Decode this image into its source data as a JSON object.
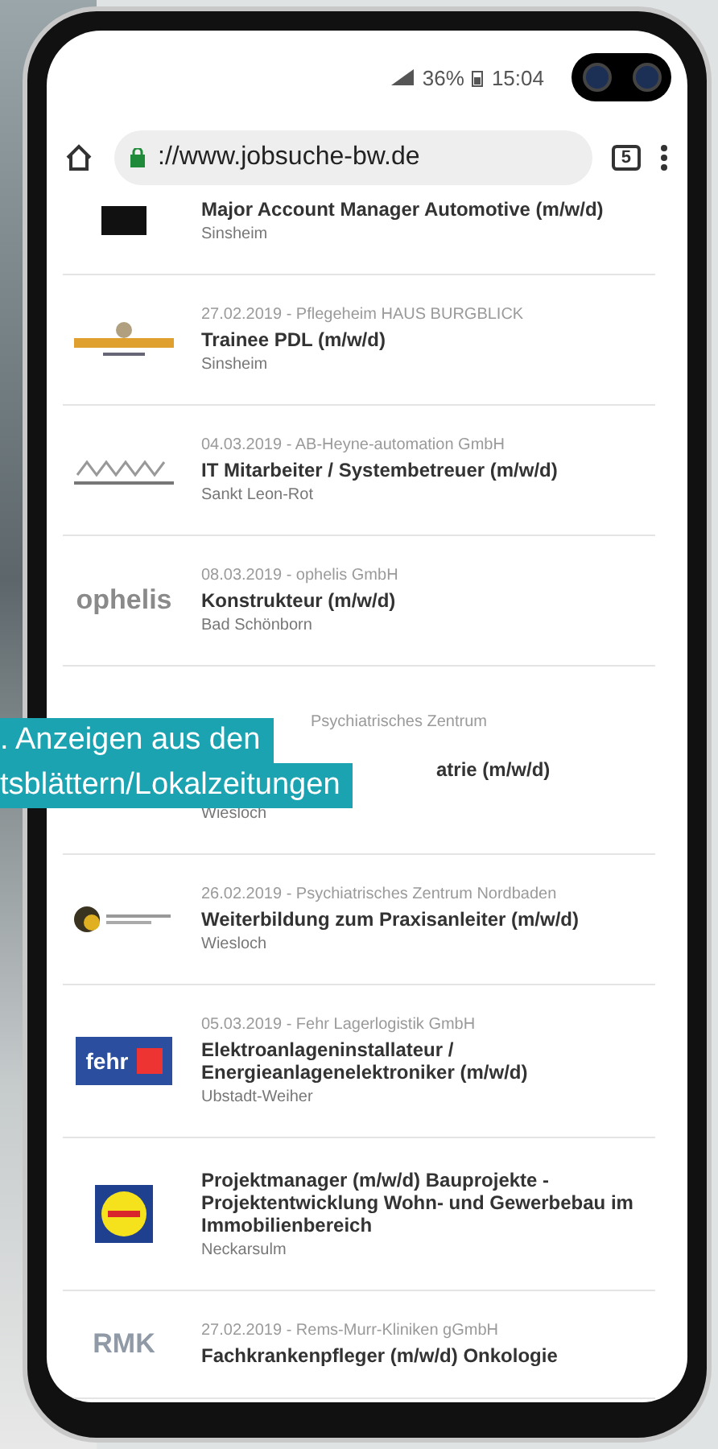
{
  "status_bar": {
    "battery": "36%",
    "time": "15:04"
  },
  "browser": {
    "url": "://www.jobsuche-bw.de",
    "tab_count": "5"
  },
  "jobs": [
    {
      "kind": "plain",
      "logo": {
        "kind": "dark"
      },
      "title": "Major Account Manager Automotive (m/w/d)",
      "location": "Sinsheim"
    },
    {
      "kind": "plain",
      "logo": {
        "kind": "crest"
      },
      "meta": "27.02.2019 - Pflegeheim HAUS BURGBLICK",
      "title": "Trainee PDL (m/w/d)",
      "location": "Sinsheim"
    },
    {
      "kind": "plain",
      "logo": {
        "kind": "outline"
      },
      "meta": "04.03.2019 - AB-Heyne-automation GmbH",
      "title": "IT Mitarbeiter / Systembetreuer (m/w/d)",
      "location": "Sankt Leon-Rot"
    },
    {
      "kind": "plain",
      "logo": {
        "kind": "word",
        "text": "ophelis",
        "color": "#8a8a8a"
      },
      "meta": "08.03.2019 - ophelis GmbH",
      "title": "Konstrukteur (m/w/d)",
      "location": "Bad Schönborn"
    },
    {
      "kind": "covered",
      "meta": "Psychiatrisches Zentrum",
      "title": "atrie (m/w/d)",
      "location": "Wiesloch"
    },
    {
      "kind": "plain",
      "logo": {
        "kind": "emblem"
      },
      "meta": "26.02.2019 - Psychiatrisches Zentrum Nordbaden",
      "title": "Weiterbildung zum Praxisanleiter (m/w/d)",
      "location": "Wiesloch"
    },
    {
      "kind": "plain",
      "logo": {
        "kind": "box",
        "text": "fehr",
        "color": "#2b4f9e"
      },
      "meta": "05.03.2019 - Fehr Lagerlogistik GmbH",
      "title": "Elektroanlageninstallateur / Energieanlagenelektroniker (m/w/d)",
      "location": "Ubstadt-Weiher"
    },
    {
      "kind": "plain",
      "logo": {
        "kind": "roundel"
      },
      "title": "Projektmanager (m/w/d) Bauprojekte - Projektentwicklung Wohn- und Gewerbebau im Immobilienbereich",
      "location": "Neckarsulm"
    },
    {
      "kind": "plain",
      "logo": {
        "kind": "word",
        "text": "RMK",
        "color": "#8f9aa6"
      },
      "meta": "27.02.2019 - Rems-Murr-Kliniken gGmbH",
      "title": "Fachkrankenpfleger (m/w/d) Onkologie"
    }
  ],
  "caption": {
    "lines": [
      ". Anzeigen aus den",
      "tsblättern/Lokalzeitungen"
    ]
  }
}
